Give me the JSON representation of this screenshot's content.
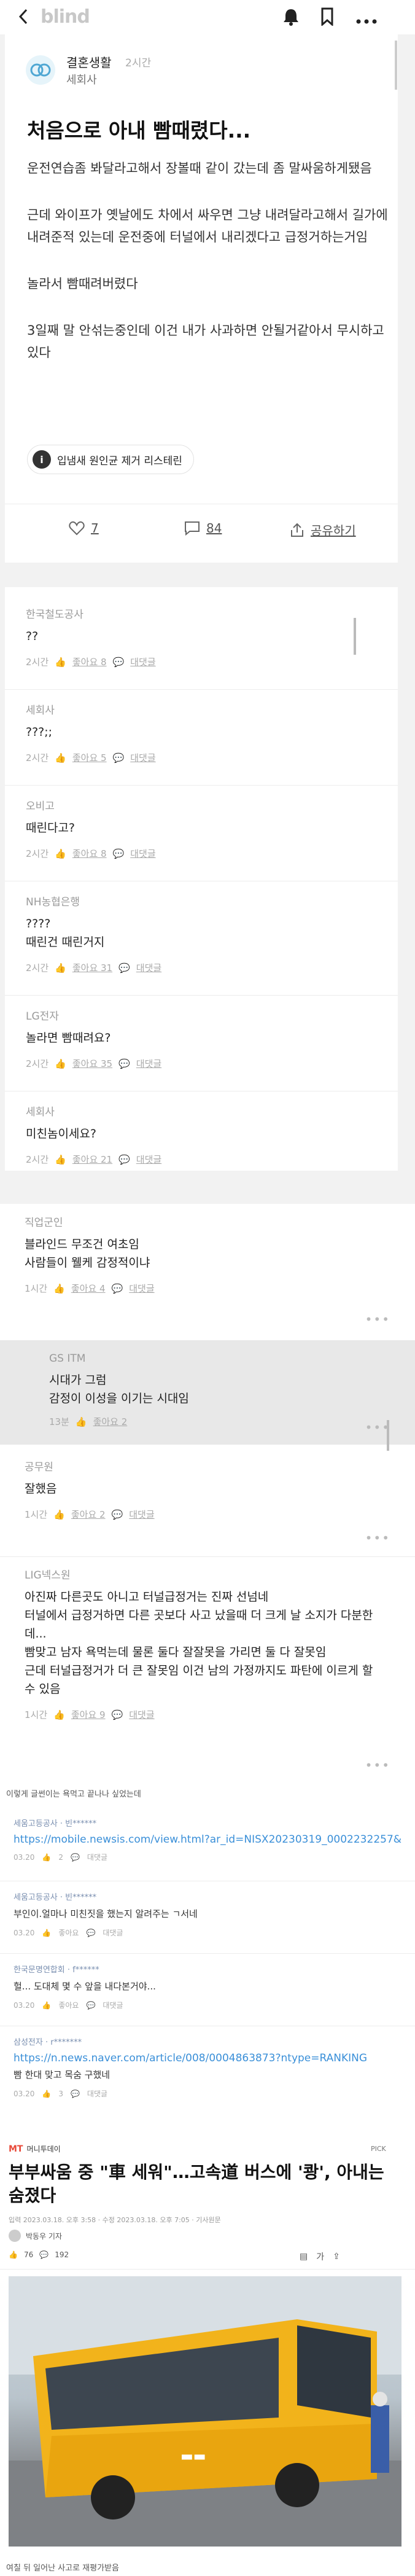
{
  "header": {
    "logo": "blind",
    "icons": [
      "back-icon",
      "bell-icon",
      "bookmark-icon",
      "more-icon"
    ]
  },
  "post": {
    "author": "결혼생활",
    "time": "2시간",
    "company": "세회사",
    "title": "처음으로 아내 빰때렸다...",
    "paragraphs": [
      "운전연습좀 봐달라고해서 장볼때 같이 갔는데 좀 말싸움하게됐음",
      "근데 와이프가 옛날에도 차에서 싸우면 그냥 내려달라고해서 길가에 내려준적 있는데 운전중에 터널에서 내리겠다고 급정거하는거임",
      "놀라서 빰때려버렸다",
      "3일째 말 안섞는중인데 이건 내가 사과하면 안될거같아서 무시하고있다"
    ],
    "promo": "입냄새 원인균 제거 리스테린",
    "likes": "7",
    "comments": "84",
    "share": "공유하기"
  },
  "comments1": [
    {
      "company": "한국철도공사",
      "text": "??",
      "time": "2시간",
      "likes": "좋아요 8",
      "reply": "대댓글"
    },
    {
      "company": "세회사",
      "text": "???;;",
      "time": "2시간",
      "likes": "좋아요 5",
      "reply": "대댓글"
    },
    {
      "company": "오비고",
      "text": "때린다고?",
      "time": "2시간",
      "likes": "좋아요 8",
      "reply": "대댓글"
    },
    {
      "company": "NH농협은행",
      "text": "????\n때린건 때린거지",
      "time": "2시간",
      "likes": "좋아요 31",
      "reply": "대댓글"
    },
    {
      "company": "LG전자",
      "text": "놀라면 빰때려요?",
      "time": "2시간",
      "likes": "좋아요 35",
      "reply": "대댓글"
    },
    {
      "company": "세회사",
      "text": "미친놈이세요?",
      "time": "2시간",
      "likes": "좋아요 21",
      "reply": "대댓글"
    }
  ],
  "comments2": [
    {
      "company": "직업군인",
      "text": "블라인드 무조건 여초임\n사람들이 웰케 감정적이냐",
      "time": "1시간",
      "likes": "좋아요 4",
      "reply": "대댓글",
      "highlight": false
    },
    {
      "company": "GS ITM",
      "text": "시대가 그럼\n감정이 이성을 이기는 시대임",
      "time": "13분",
      "likes": "좋아요 2",
      "reply": "",
      "highlight": true
    },
    {
      "company": "공무원",
      "text": "잘했음",
      "time": "1시간",
      "likes": "좋아요 2",
      "reply": "대댓글",
      "highlight": false
    },
    {
      "company": "LIG넥스원",
      "text": "아진짜 다른곳도 아니고 터널급정거는 진짜 선넘네\n터널에서 급정거하면 다른 곳보다 사고 났을때 더 크게 날 소지가 다분한데...\n빰맞고 남자 욕먹는데 물론 둘다 잘잘못을 가리면 둘 다 잘못임\n근데 터널급정거가 더 큰 잘못임 이건 남의 가정까지도 파탄에 이르게 할 수 있음",
      "time": "1시간",
      "likes": "좋아요 9",
      "reply": "대댓글",
      "highlight": false
    }
  ],
  "caption1": "이렇게 글썬이는 욕먹고 끝나나 싶었는데",
  "comments3": [
    {
      "company": "세움고등공사 · 빈******",
      "link": "https://mobile.newsis.com/view.html?ar_id=NISX20230319_0002232257&",
      "date": "03.20",
      "likes": "2",
      "reply": "대댓글"
    },
    {
      "company": "세움고등공사 · 빈******",
      "text": "부인이.얼마나 미친짓을 했는지 알려주는 ㄱ서네",
      "date": "03.20",
      "likes": "좋아요",
      "reply": "대댓글"
    },
    {
      "company": "한국문명연합회 · f******",
      "text": "헐... 도대체 몇 수 앞을 내다본거야...",
      "date": "03.20",
      "likes": "좋아요",
      "reply": "대댓글"
    },
    {
      "company": "삼성전자 · r*******",
      "link": "https://n.news.naver.com/article/008/0004863873?ntype=RANKING",
      "text": "빰 한대 맞고 목숨 구했네",
      "date": "03.20",
      "likes": "3",
      "reply": "대댓글"
    }
  ],
  "article": {
    "source": "머니투데이",
    "pick": "PICK",
    "headline": "부부싸움 중 \"車 세워\"…고속道 버스에 '쾅', 아내는 숨졌다",
    "meta": "입력 2023.03.18. 오후 3:58 · 수정 2023.03.18. 오후 7:05 · 기사원문",
    "reporter": "박동우 기자",
    "likes": "76",
    "comments": "192"
  },
  "caption2": "여칠 뒤 일어난 사고로 재평가받음",
  "colors": {
    "accent": "#ea4d3c",
    "blue": "#3a8fd8",
    "bg_gray": "#f0f0f0"
  }
}
